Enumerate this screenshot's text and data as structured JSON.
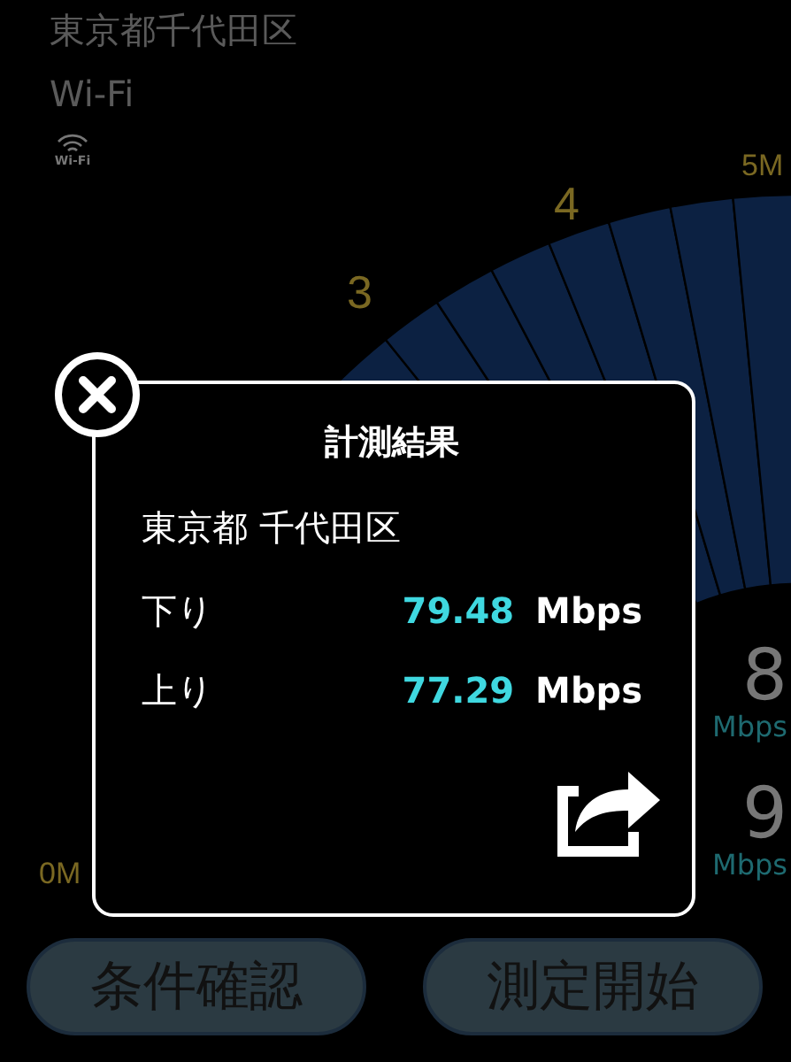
{
  "header": {
    "location": "東京都千代田区",
    "network": "Wi-Fi",
    "network_icon_label": "Wi-Fi"
  },
  "gauge": {
    "ticks": [
      {
        "label": "0M"
      },
      {
        "label": "3"
      },
      {
        "label": "4"
      },
      {
        "label": "5M"
      }
    ]
  },
  "readings": [
    {
      "value": "8",
      "unit": "Mbps"
    },
    {
      "value": "9",
      "unit": "Mbps"
    }
  ],
  "dialog": {
    "title": "計測結果",
    "location": "東京都 千代田区",
    "rows": [
      {
        "label": "下り",
        "value": "79.48",
        "unit": "Mbps"
      },
      {
        "label": "上り",
        "value": "77.29",
        "unit": "Mbps"
      }
    ]
  },
  "buttons": [
    {
      "label": "条件確認"
    },
    {
      "label": "測定開始"
    }
  ]
}
